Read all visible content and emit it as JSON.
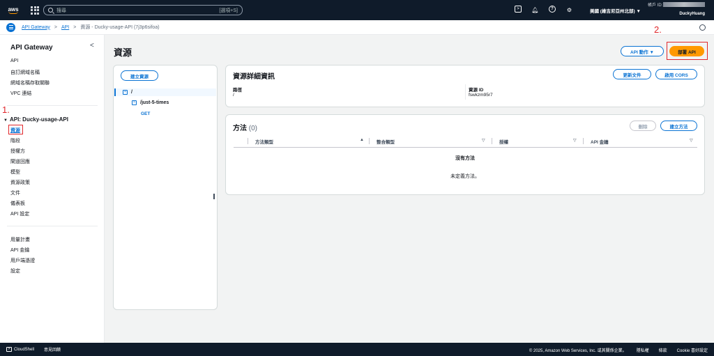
{
  "topnav": {
    "logo": "aws",
    "search_placeholder": "搜尋",
    "search_shortcut": "[選項+S]",
    "region": "美國 (維吉尼亞州北部) ▼",
    "account_label": "帳戶 ID:",
    "username": "DuckyHuang",
    "icons": [
      "cloudshell-icon",
      "bell-icon",
      "help-icon",
      "gear-icon"
    ]
  },
  "breadcrumb": {
    "items": [
      "API Gateway",
      "API",
      "資源 - Ducky-usage-API (7j3p6sifoa)"
    ]
  },
  "sidebar": {
    "title": "API Gateway",
    "top_items": [
      "API",
      "自訂網域名稱",
      "網域名稱存取關聯",
      "VPC 連結"
    ],
    "group": {
      "label": "API: Ducky-usage-API",
      "items": [
        "資源",
        "階段",
        "授權方",
        "閘道回應",
        "模型",
        "資源政策",
        "文件",
        "儀表板",
        "API 設定"
      ]
    },
    "bottom_items": [
      "用量計畫",
      "API 金鑰",
      "用戶端憑證",
      "設定"
    ]
  },
  "annotations": {
    "first": "1.",
    "second": "2."
  },
  "main": {
    "title": "資源",
    "api_actions_label": "API 動作 ▼",
    "deploy_label": "部署 API",
    "create_resource_label": "建立資源",
    "tree": {
      "root": "/",
      "child": "/just-5-times",
      "method": "GET"
    },
    "details": {
      "title": "資源詳細資訊",
      "update_doc_label": "更新文件",
      "enable_cors_label": "啟用 CORS",
      "path_label": "路徑",
      "path_value": "/",
      "id_label": "資源 ID",
      "id_value": "fswkzm95r7"
    },
    "methods": {
      "title": "方法",
      "count": "(0)",
      "delete_label": "刪除",
      "create_label": "建立方法",
      "columns": [
        "方法類型",
        "整合類型",
        "授權",
        "API 金鑰"
      ],
      "empty_title": "沒有方法",
      "empty_sub": "未定義方法。"
    }
  },
  "footer": {
    "cloudshell": "CloudShell",
    "feedback": "意見回饋",
    "copyright": "© 2025, Amazon Web Services, Inc. 或其關係企業。",
    "privacy": "隱私權",
    "terms": "條款",
    "cookies": "Cookie 喜好設定"
  },
  "colors": {
    "accent": "#0972d3",
    "primary_button": "#ff9900",
    "nav_bg": "#0f1b2a",
    "annotation": "#e0272b"
  }
}
